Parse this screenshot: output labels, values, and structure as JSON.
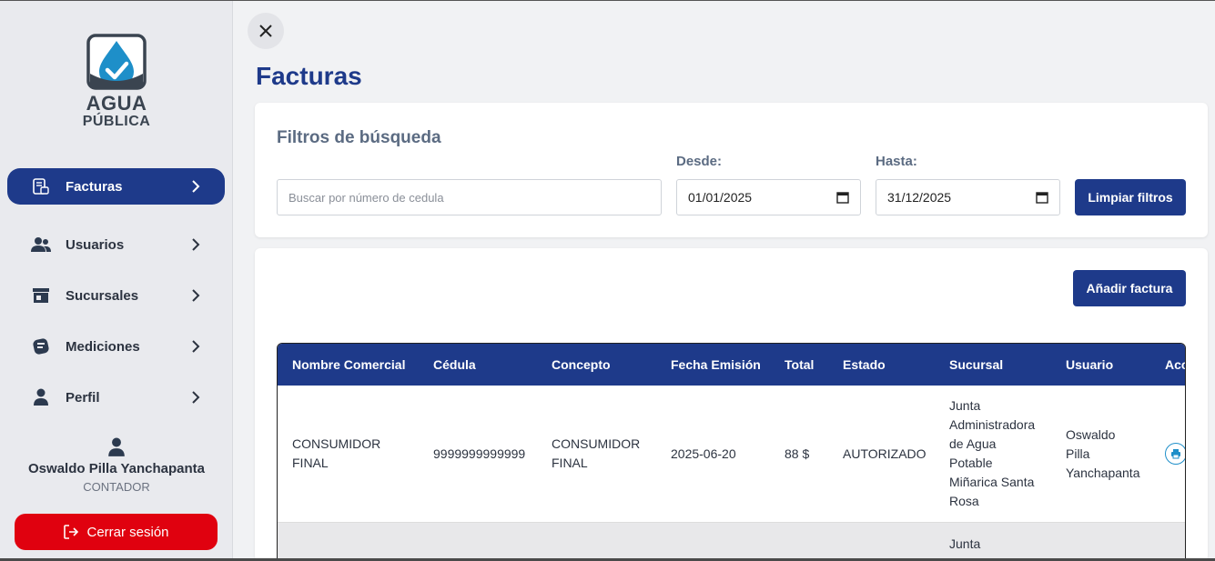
{
  "sidebar": {
    "logo": {
      "line1": "AGUA",
      "line2": "PÚBLICA"
    },
    "items": [
      {
        "label": "Facturas",
        "icon": "invoice-icon",
        "active": true
      },
      {
        "label": "Usuarios",
        "icon": "users-icon",
        "active": false
      },
      {
        "label": "Sucursales",
        "icon": "store-icon",
        "active": false
      },
      {
        "label": "Mediciones",
        "icon": "meter-icon",
        "active": false
      },
      {
        "label": "Perfil",
        "icon": "person-icon",
        "active": false
      }
    ],
    "user": {
      "name": "Oswaldo Pilla Yanchapanta",
      "role": "CONTADOR"
    },
    "logout_label": "Cerrar sesión"
  },
  "page": {
    "title": "Facturas"
  },
  "filters": {
    "title": "Filtros de búsqueda",
    "search_placeholder": "Buscar por número de cedula",
    "desde_label": "Desde:",
    "desde_value": "01/01/2025",
    "hasta_label": "Hasta:",
    "hasta_value": "31/12/2025",
    "clear_label": "Limpiar filtros"
  },
  "table": {
    "add_label": "Añadir factura",
    "columns": [
      "Nombre Comercial",
      "Cédula",
      "Concepto",
      "Fecha Emisión",
      "Total",
      "Estado",
      "Sucursal",
      "Usuario",
      "Acc"
    ],
    "rows": [
      {
        "nombre": [
          "CONSUMIDOR",
          "FINAL"
        ],
        "cedula": "9999999999999",
        "concepto": [
          "CONSUMIDOR",
          "FINAL"
        ],
        "fecha": "2025-06-20",
        "total": "88 $",
        "estado": "AUTORIZADO",
        "sucursal": [
          "Junta",
          "Administradora",
          "de Agua",
          "Potable",
          "Miñarica Santa",
          "Rosa"
        ],
        "usuario": [
          "Oswaldo",
          "Pilla",
          "Yanchapanta"
        ]
      },
      {
        "sucursal": [
          "Junta"
        ]
      }
    ]
  },
  "colors": {
    "primary": "#1e3a8a",
    "danger": "#e0010f",
    "sidebar_bg": "#e9eaee"
  }
}
